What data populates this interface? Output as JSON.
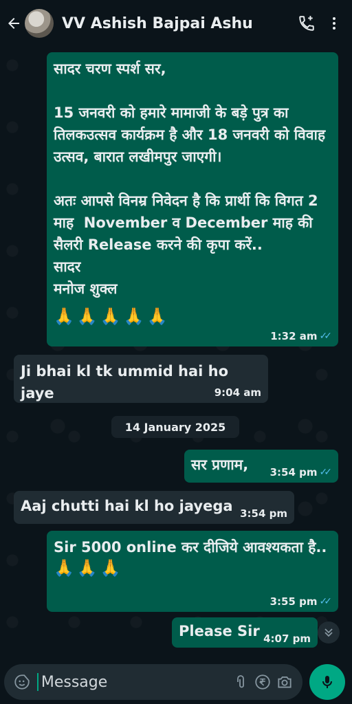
{
  "header": {
    "contact_name": "VV Ashish Bajpai Ashu"
  },
  "messages": [
    {
      "direction": "out",
      "text": "सादर चरण स्पर्श सर,\n\n15 जनवरी को हमारे मामाजी के बड़े पुत्र का तिलकउत्सव कार्यक्रम है और 18 जनवरी को विवाह उत्सव, बारात लखीमपुर जाएगी।\n\nअतः आपसे विनम्र निवेदन है कि प्रार्थी कि विगत 2 माह  November व December माह की सैलरी Release करने की कृपा करें..\nसादर\nमनोज शुक्ल",
      "emojis": "🙏🙏🙏🙏🙏",
      "time": "1:32 am",
      "read": true
    },
    {
      "direction": "in",
      "text": "Ji bhai kl tk ummid hai ho jaye",
      "time": "9:04 am"
    },
    {
      "direction": "out",
      "text": "सर प्रणाम,",
      "time": "3:54 pm",
      "read": true
    },
    {
      "direction": "in",
      "text": "Aaj chutti hai kl ho jayega",
      "time": "3:54 pm"
    },
    {
      "direction": "out",
      "text": "Sir 5000 online कर दीजिये आवश्यकता है..",
      "emojis": "🙏🙏🙏",
      "time": "3:55 pm",
      "read": true
    },
    {
      "direction": "out",
      "text": "Please Sir",
      "time": "4:07 pm"
    }
  ],
  "date_separator": "14 January 2025",
  "composer": {
    "placeholder": "Message"
  },
  "icons": {
    "back": "back-arrow-icon",
    "call": "add-call-icon",
    "menu": "more-vert-icon",
    "sticker": "sticker-icon",
    "attach": "paperclip-icon",
    "payment": "rupee-icon",
    "camera": "camera-icon",
    "mic": "mic-icon",
    "scroll": "double-chevron-down-icon"
  },
  "colors": {
    "outgoing_bubble": "#005c4b",
    "incoming_bubble": "#202c33",
    "accent": "#00a884",
    "read_ticks": "#53bdeb"
  }
}
